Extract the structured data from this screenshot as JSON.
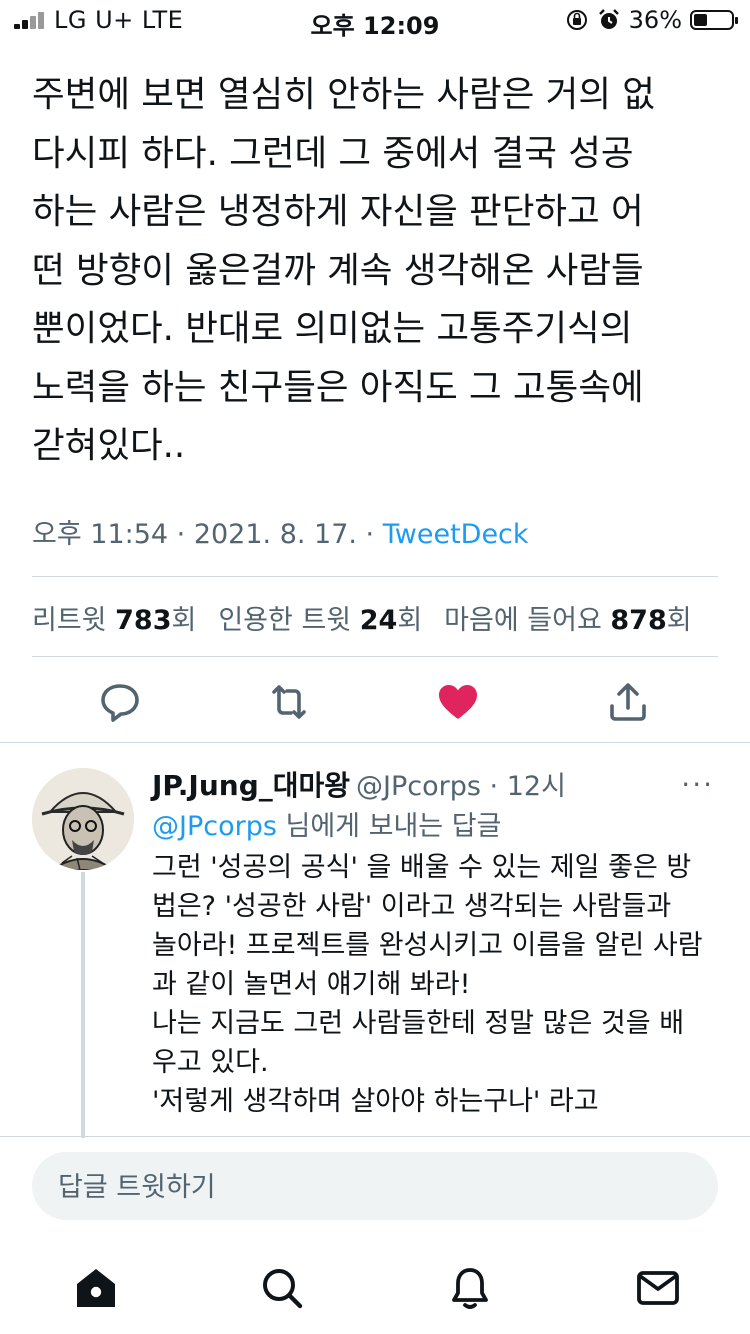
{
  "status_bar": {
    "carrier": "LG U+  LTE",
    "time": "오후 12:09",
    "battery": "36%",
    "battery_level": 0.36
  },
  "tweet": {
    "text": "주변에 보면 열심히 안하는 사람은 거의 없\n다시피 하다. 그런데 그 중에서 결국 성공\n하는 사람은 냉정하게 자신을 판단하고 어\n떤 방향이 옳은걸까 계속 생각해온 사람들\n뿐이었다. 반대로 의미없는 고통주기식의\n노력을 하는 친구들은 아직도 그 고통속에\n갇혀있다..",
    "timestamp": "오후 11:54 · 2021. 8. 17. · ",
    "source": "TweetDeck",
    "stats": {
      "retweets_label": "리트윗",
      "retweets_count": "783",
      "retweets_unit": "회",
      "quotes_label": "인용한 트윗",
      "quotes_count": "24",
      "quotes_unit": "회",
      "likes_label": "마음에 들어요",
      "likes_count": "878",
      "likes_unit": "회"
    },
    "liked": true,
    "accent_like": "#f91880",
    "accent_link": "#1d9bf0"
  },
  "reply": {
    "name": "JP.Jung_대마왕",
    "handle": "@JPcorps",
    "sep": " · ",
    "time": "12시",
    "more": "···",
    "replying_handle": "@JPcorps",
    "replying_suffix": " 님에게 보내는 답글",
    "text": "그런 '성공의 공식' 을 배울 수 있는 제일 좋은 방\n법은? '성공한 사람' 이라고 생각되는 사람들과\n놀아라! 프로젝트를 완성시키고 이름을 알린 사람\n과 같이 놀면서 얘기해 봐라!\n나는 지금도 그런 사람들한테 정말 많은 것을 배\n우고 있다.\n'저렇게 생각하며 살아야 하는구나' 라고"
  },
  "composer": {
    "placeholder": "답글 트윗하기"
  },
  "tab_bar": {
    "items": [
      "home-icon",
      "search-icon",
      "notifications-icon",
      "messages-icon"
    ]
  }
}
